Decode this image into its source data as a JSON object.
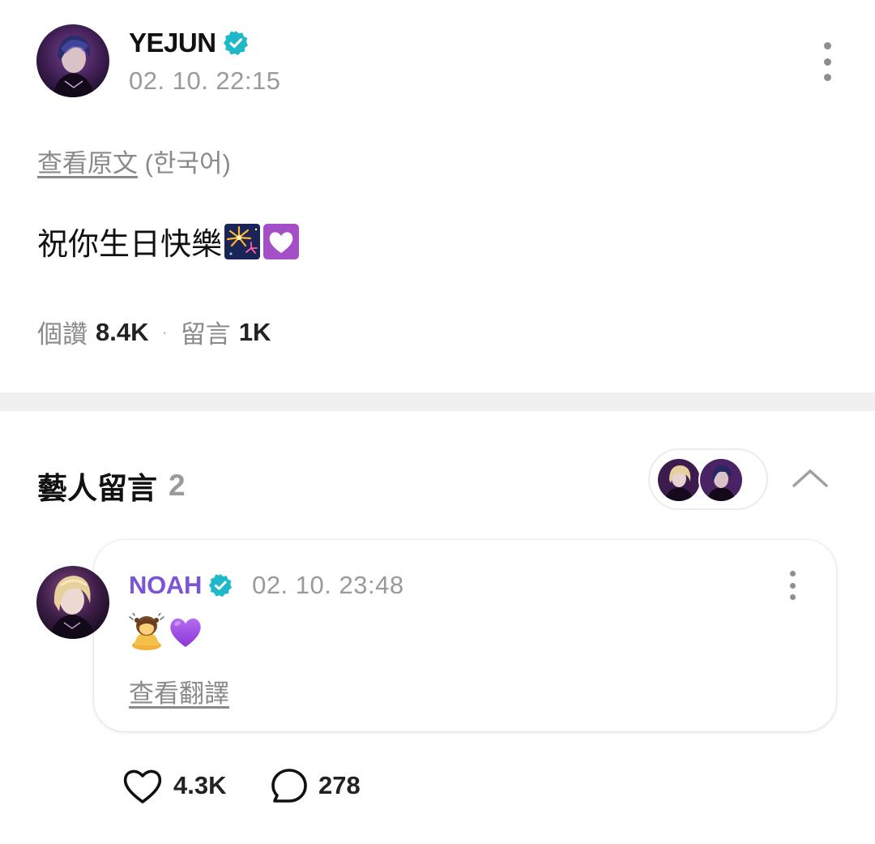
{
  "post": {
    "author": "YEJUN",
    "time": "02. 10. 22:15",
    "view_original_link": "查看原文",
    "original_language": "(한국어)",
    "body_text": "祝你生日快樂",
    "body_emojis": [
      "fireworks-emoji",
      "white-heart-emoji"
    ],
    "likes_label": "個讚",
    "likes_count": "8.4K",
    "separator": "·",
    "comments_label": "留言",
    "comments_count": "1K"
  },
  "artist_comments": {
    "title": "藝人留言",
    "count": "2",
    "comment": {
      "author": "NOAH",
      "time": "02. 10. 23:48",
      "emojis": [
        "girl-bowing-emoji",
        "purple-heart-emoji"
      ],
      "translate_link": "查看翻譯",
      "like_count": "4.3K",
      "reply_count": "278"
    }
  },
  "colors": {
    "verified_badge": "#1fb8c9",
    "artist_name": "#7a55d6",
    "muted_text": "#8a8a8a",
    "divider": "#f0f0f0"
  },
  "icons": [
    "verified-badge-icon",
    "more-options-icon",
    "chevron-up-icon",
    "heart-icon",
    "comment-bubble-icon"
  ]
}
